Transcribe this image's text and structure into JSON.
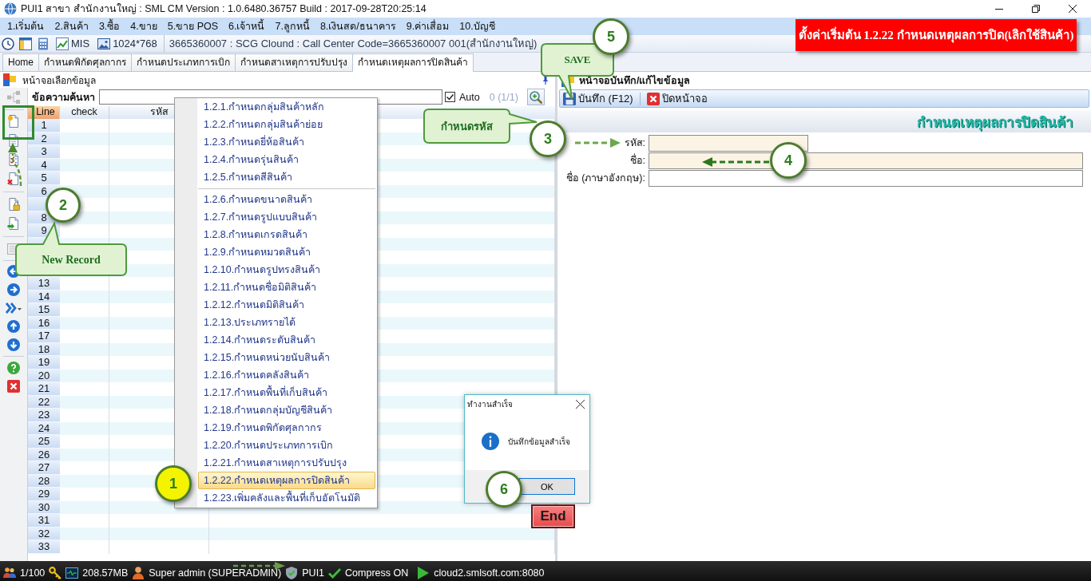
{
  "window": {
    "title": "PUI1 สาขา สำนักงานใหญ่ : SML CM Version : 1.0.6480.36757 Build : 2017-09-28T20:25:14"
  },
  "menu_bar": [
    "1.เริ่มต้น",
    "2.สินค้า",
    "3.ซื้อ",
    "4.ขาย",
    "5.ขาย POS",
    "6.เจ้าหนี้",
    "7.ลูกหนี้",
    "8.เงินสด/ธนาคาร",
    "9.ค่าเสื่อม",
    "10.บัญชี"
  ],
  "toolbar": {
    "mis": "MIS",
    "resolution": "1024*768",
    "connection": "3665360007 : SCG Clound : Call Center Code=3665360007 001(สำนักงานใหญ่)"
  },
  "tabs": [
    {
      "label": "Home",
      "selected": false
    },
    {
      "label": "กำหนดพิกัดศุลกากร",
      "selected": false
    },
    {
      "label": "กำหนดประเภทการเบิก",
      "selected": false
    },
    {
      "label": "กำหนดสาเหตุการปรับปรุง",
      "selected": false
    },
    {
      "label": "กำหนดเหตุผลการปิดสินค้า",
      "selected": true
    }
  ],
  "list_panel": {
    "title": "หน้าจอเลือกข้อมูล",
    "search_label": "ข้อความค้นหา",
    "auto": {
      "label": "Auto",
      "checked": true
    },
    "count": "0 (1/1)"
  },
  "grid": {
    "columns": [
      "Line",
      "check",
      "รหัส"
    ],
    "rows_upper": [
      "1",
      "2",
      "3",
      "4",
      "5",
      "6"
    ],
    "rows_middle": [
      "8",
      "9"
    ],
    "rows_lower": [
      "13",
      "14",
      "15",
      "16",
      "17",
      "18",
      "19",
      "20",
      "21",
      "22",
      "23",
      "24",
      "25",
      "26",
      "27",
      "28",
      "29",
      "30",
      "31",
      "32",
      "33"
    ]
  },
  "dropdown_menu": {
    "groups": [
      [
        {
          "label": "1.2.1.กำหนดกลุ่มสินค้าหลัก",
          "selected": false
        },
        {
          "label": "1.2.2.กำหนดกลุ่มสินค้าย่อย",
          "selected": false
        },
        {
          "label": "1.2.3.กำหนดยี่ห้อสินค้า",
          "selected": false
        },
        {
          "label": "1.2.4.กำหนดรุ่นสินค้า",
          "selected": false
        },
        {
          "label": "1.2.5.กำหนดสีสินค้า",
          "selected": false
        }
      ],
      [
        {
          "label": "1.2.6.กำหนดขนาดสินค้า",
          "selected": false
        },
        {
          "label": "1.2.7.กำหนดรูปแบบสินค้า",
          "selected": false
        },
        {
          "label": "1.2.8.กำหนดเกรดสินค้า",
          "selected": false
        },
        {
          "label": "1.2.9.กำหนดหมวดสินค้า",
          "selected": false
        },
        {
          "label": "1.2.10.กำหนดรูปทรงสินค้า",
          "selected": false
        },
        {
          "label": "1.2.11.กำหนดชื่อมิติสินค้า",
          "selected": false
        },
        {
          "label": "1.2.12.กำหนดมิติสินค้า",
          "selected": false
        },
        {
          "label": "1.2.13.ประเภทรายได้",
          "selected": false
        },
        {
          "label": "1.2.14.กำหนดระดับสินค้า",
          "selected": false
        },
        {
          "label": "1.2.15.กำหนดหน่วยนับสินค้า",
          "selected": false
        },
        {
          "label": "1.2.16.กำหนดคลังสินค้า",
          "selected": false
        },
        {
          "label": "1.2.17.กำหนดพื้นที่เก็บสินค้า",
          "selected": false
        },
        {
          "label": "1.2.18.กำหนดกลุ่มบัญชีสินค้า",
          "selected": false
        },
        {
          "label": "1.2.19.กำหนดพิกัดศุลกากร",
          "selected": false
        },
        {
          "label": "1.2.20.กำหนดประเภทการเบิก",
          "selected": false
        },
        {
          "label": "1.2.21.กำหนดสาเหตุการปรับปรุง",
          "selected": false
        },
        {
          "label": "1.2.22.กำหนดเหตุผลการปิดสินค้า",
          "selected": true
        },
        {
          "label": "1.2.23.เพิ่มคลังและพื้นที่เก็บอัตโนมัติ",
          "selected": false
        }
      ]
    ]
  },
  "edit_panel": {
    "title": "หน้าจอบันทึก/แก้ไขข้อมูล",
    "save": "บันทึก (F12)",
    "close": "ปิดหน้าจอ",
    "heading": "กำหนดเหตุผลการปิดสินค้า",
    "fields": [
      {
        "label": "รหัส:",
        "kind": "code",
        "highlighted": true
      },
      {
        "label": "ชื่อ:",
        "kind": "text",
        "highlighted": true
      },
      {
        "label": "ชื่อ (ภาษาอังกฤษ):",
        "kind": "text",
        "highlighted": false
      }
    ]
  },
  "dialog": {
    "title": "ทำงานสำเร็จ",
    "message": "บันทึกข้อมูลสำเร็จ",
    "button": "OK"
  },
  "status_bar": {
    "sessions": "1/100",
    "memory": "208.57MB",
    "user": "Super admin (SUPERADMIN)",
    "database": "PUI1",
    "compress": "Compress ON",
    "server": "cloud2.smlsoft.com:8080"
  },
  "annotations": {
    "banner": "ตั้งค่าเริ่มต้น 1.2.22 กำหนดเหตุผลการปิด(เลิกใช้สินค้า)",
    "callouts": [
      "SAVE",
      "กำหนดรหัส",
      "New Record"
    ],
    "steps": [
      {
        "number": "1",
        "color": "#f4f400"
      },
      {
        "number": "2",
        "color": "#ffffff"
      },
      {
        "number": "3",
        "color": "#ffffff"
      },
      {
        "number": "4",
        "color": "#ffffff"
      },
      {
        "number": "5",
        "color": "#ffffff"
      },
      {
        "number": "6",
        "color": "#ffffff"
      }
    ],
    "end": "End"
  }
}
